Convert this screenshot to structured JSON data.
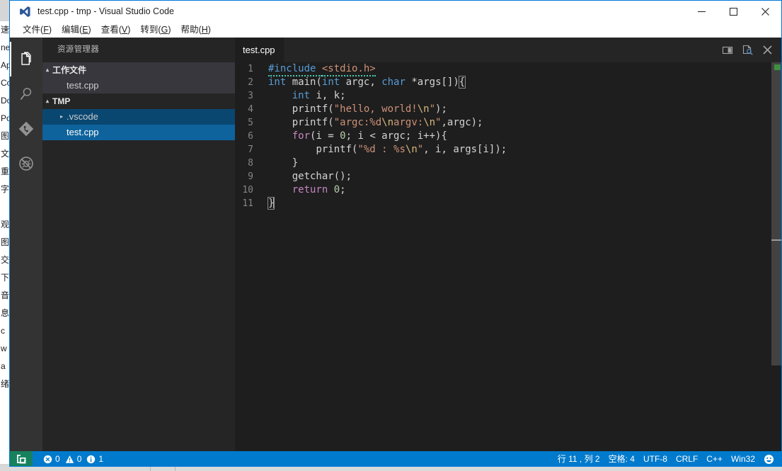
{
  "window": {
    "title": "test.cpp - tmp - Visual Studio Code",
    "logo_name": "vscode-logo-icon",
    "controls": [
      {
        "name": "minimize-button",
        "glyph": "minimize"
      },
      {
        "name": "maximize-button",
        "glyph": "maximize"
      },
      {
        "name": "close-button",
        "glyph": "close"
      }
    ]
  },
  "menubar": {
    "items": [
      {
        "label": "文件",
        "mnemonic": "F"
      },
      {
        "label": "编辑",
        "mnemonic": "E"
      },
      {
        "label": "查看",
        "mnemonic": "V"
      },
      {
        "label": "转到",
        "mnemonic": "G"
      },
      {
        "label": "帮助",
        "mnemonic": "H"
      }
    ]
  },
  "activitybar": {
    "items": [
      {
        "name": "activity-explorer",
        "icon": "files-icon",
        "active": true
      },
      {
        "name": "activity-search",
        "icon": "search-icon",
        "active": false
      },
      {
        "name": "activity-source-control",
        "icon": "source-control-icon",
        "active": false
      },
      {
        "name": "activity-debug",
        "icon": "debug-no-icon",
        "active": false
      }
    ]
  },
  "sidebar": {
    "title": "资源管理器",
    "sections": [
      {
        "label": "工作文件",
        "twisty": "▴",
        "expanded": true,
        "children": [
          {
            "label": "test.cpp",
            "indent": 34,
            "twisty": "",
            "state": "open-file"
          }
        ]
      },
      {
        "label": "TMP",
        "twisty": "▴",
        "expanded": true,
        "children": [
          {
            "label": ".vscode",
            "indent": 20,
            "twisty": "▸",
            "state": "focus"
          },
          {
            "label": "test.cpp",
            "indent": 34,
            "twisty": "",
            "state": "selected"
          }
        ]
      }
    ]
  },
  "editor": {
    "tab": {
      "label": "test.cpp",
      "active": true
    },
    "actions": [
      {
        "name": "split-editor-button",
        "icon": "split-editor-icon"
      },
      {
        "name": "open-preview-button",
        "icon": "preview-icon"
      },
      {
        "name": "close-editor-button",
        "icon": "close-icon"
      }
    ],
    "lines": [
      {
        "num": "1",
        "tokens": [
          {
            "t": "#include ",
            "c": "pp",
            "squiggle": true
          },
          {
            "t": "<stdio.h>",
            "c": "inc",
            "squiggle": true
          }
        ]
      },
      {
        "num": "2",
        "tokens": [
          {
            "t": "int",
            "c": "k"
          },
          {
            "t": " ",
            "c": "pl"
          },
          {
            "t": "main",
            "c": "pl"
          },
          {
            "t": "(",
            "c": "pl"
          },
          {
            "t": "int",
            "c": "k"
          },
          {
            "t": " argc, ",
            "c": "pl"
          },
          {
            "t": "char",
            "c": "k"
          },
          {
            "t": " *args[])",
            "c": "pl"
          },
          {
            "t": "{",
            "c": "pl",
            "bracket": true
          }
        ]
      },
      {
        "num": "3",
        "tokens": [
          {
            "t": "    ",
            "c": "pl"
          },
          {
            "t": "int",
            "c": "k"
          },
          {
            "t": " i, k;",
            "c": "pl"
          }
        ]
      },
      {
        "num": "4",
        "tokens": [
          {
            "t": "    ",
            "c": "pl"
          },
          {
            "t": "printf",
            "c": "pl"
          },
          {
            "t": "(",
            "c": "pl"
          },
          {
            "t": "\"hello, world!",
            "c": "str"
          },
          {
            "t": "\\n",
            "c": "esc"
          },
          {
            "t": "\"",
            "c": "str"
          },
          {
            "t": ");",
            "c": "pl"
          }
        ]
      },
      {
        "num": "5",
        "tokens": [
          {
            "t": "    ",
            "c": "pl"
          },
          {
            "t": "printf",
            "c": "pl"
          },
          {
            "t": "(",
            "c": "pl"
          },
          {
            "t": "\"argc:%d",
            "c": "str"
          },
          {
            "t": "\\n",
            "c": "esc"
          },
          {
            "t": "argv:",
            "c": "str"
          },
          {
            "t": "\\n",
            "c": "esc"
          },
          {
            "t": "\"",
            "c": "str"
          },
          {
            "t": ",argc);",
            "c": "pl"
          }
        ]
      },
      {
        "num": "6",
        "tokens": [
          {
            "t": "    ",
            "c": "pl"
          },
          {
            "t": "for",
            "c": "kc"
          },
          {
            "t": "(i = ",
            "c": "pl"
          },
          {
            "t": "0",
            "c": "num"
          },
          {
            "t": "; i < argc; i++){",
            "c": "pl"
          }
        ]
      },
      {
        "num": "7",
        "tokens": [
          {
            "t": "        ",
            "c": "pl"
          },
          {
            "t": "printf",
            "c": "pl"
          },
          {
            "t": "(",
            "c": "pl"
          },
          {
            "t": "\"%d : %s",
            "c": "str"
          },
          {
            "t": "\\n",
            "c": "esc"
          },
          {
            "t": "\"",
            "c": "str"
          },
          {
            "t": ", i, args[i]);",
            "c": "pl"
          }
        ]
      },
      {
        "num": "8",
        "tokens": [
          {
            "t": "    }",
            "c": "pl"
          }
        ]
      },
      {
        "num": "9",
        "tokens": [
          {
            "t": "    ",
            "c": "pl"
          },
          {
            "t": "getchar",
            "c": "pl"
          },
          {
            "t": "();",
            "c": "pl"
          }
        ]
      },
      {
        "num": "10",
        "tokens": [
          {
            "t": "    ",
            "c": "pl"
          },
          {
            "t": "return",
            "c": "kc"
          },
          {
            "t": " ",
            "c": "pl"
          },
          {
            "t": "0",
            "c": "num"
          },
          {
            "t": ";",
            "c": "pl"
          }
        ]
      },
      {
        "num": "11",
        "tokens": [
          {
            "t": "}",
            "c": "pl",
            "bracket": true,
            "caret": true
          }
        ]
      }
    ]
  },
  "statusbar": {
    "remote_icon": "remote-window-icon",
    "problems": {
      "error_icon": "error-icon",
      "error_count": "0",
      "warning_icon": "warning-icon",
      "warning_count": "0",
      "info_icon": "info-icon",
      "info_count": "1"
    },
    "right_items": [
      {
        "name": "status-cursor-position",
        "label": "行 11 , 列 2"
      },
      {
        "name": "status-indentation",
        "label": "空格: 4"
      },
      {
        "name": "status-encoding",
        "label": "UTF-8"
      },
      {
        "name": "status-eol",
        "label": "CRLF"
      },
      {
        "name": "status-language-mode",
        "label": "C++"
      },
      {
        "name": "status-platform",
        "label": "Win32"
      }
    ],
    "feedback_icon": "smiley-icon",
    "accent_color": "#007acc",
    "remote_color": "#16825d"
  },
  "background_window": {
    "lines": [
      "速",
      "ne",
      "Ap",
      "Co",
      "Do",
      "Po",
      "图",
      "文",
      "重",
      "字",
      "",
      "观",
      "图",
      "交",
      "下",
      "音",
      "息",
      "c",
      "w",
      "a",
      "绪"
    ]
  }
}
